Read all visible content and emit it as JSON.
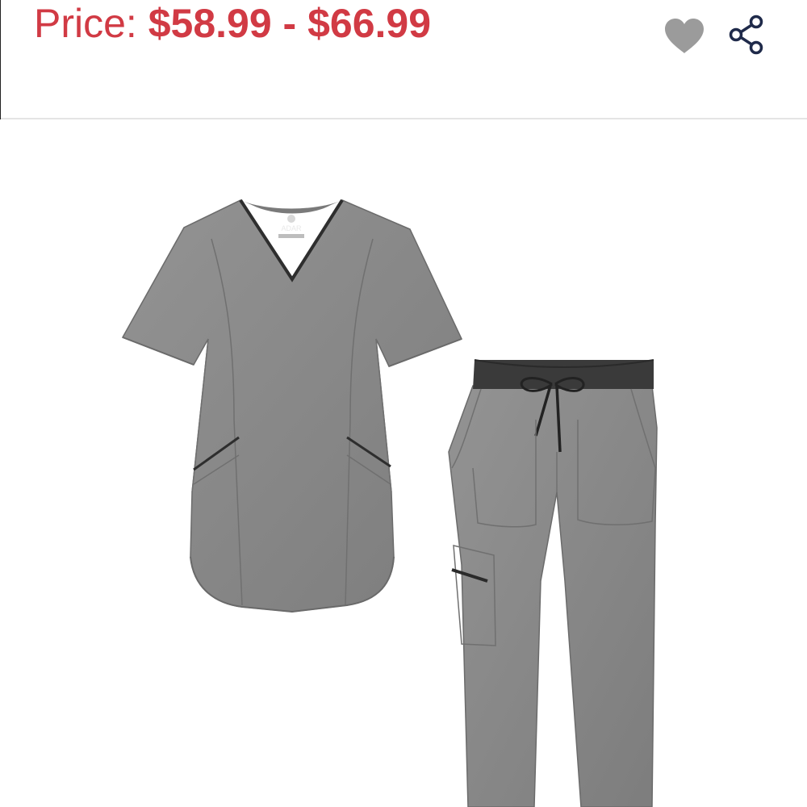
{
  "header": {
    "price_label": "Price:",
    "price_range": "$58.99 - $66.99",
    "price_color": "#d13a44"
  },
  "actions": {
    "wishlist_icon": "heart-icon",
    "share_icon": "share-icon",
    "icon_gray": "#9b9b9b",
    "icon_navy": "#1f2a4a"
  },
  "product": {
    "image": "scrub-set-image",
    "top_logo_text": "ADAR",
    "garment_color": "#8a8a8a",
    "trim_color": "#2e2e2e"
  }
}
